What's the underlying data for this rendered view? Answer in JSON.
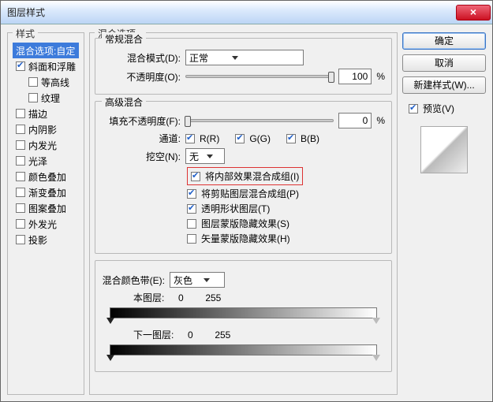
{
  "title": "图层样式",
  "left": {
    "legend": "样式",
    "items": [
      {
        "label": "混合选项:自定",
        "checked": null,
        "selected": true
      },
      {
        "label": "斜面和浮雕",
        "checked": true
      },
      {
        "label": "等高线",
        "checked": false,
        "indent": true
      },
      {
        "label": "纹理",
        "checked": false,
        "indent": true
      },
      {
        "label": "描边",
        "checked": false
      },
      {
        "label": "内阴影",
        "checked": false
      },
      {
        "label": "内发光",
        "checked": false
      },
      {
        "label": "光泽",
        "checked": false
      },
      {
        "label": "颜色叠加",
        "checked": false
      },
      {
        "label": "渐变叠加",
        "checked": false
      },
      {
        "label": "图案叠加",
        "checked": false
      },
      {
        "label": "外发光",
        "checked": false
      },
      {
        "label": "投影",
        "checked": false
      }
    ]
  },
  "mid": {
    "legend": "混合选项",
    "normal": {
      "legend": "常规混合",
      "mode_label": "混合模式(D):",
      "mode_value": "正常",
      "opacity_label": "不透明度(O):",
      "opacity_value": "100",
      "pct": "%"
    },
    "adv": {
      "legend": "高级混合",
      "fill_label": "填充不透明度(F):",
      "fill_value": "0",
      "pct": "%",
      "channels_label": "通道:",
      "r": "R(R)",
      "g": "G(G)",
      "b": "B(B)",
      "knock_label": "挖空(N):",
      "knock_value": "无",
      "opts": [
        {
          "label": "将内部效果混合成组(I)",
          "checked": true,
          "hl": true
        },
        {
          "label": "将剪贴图层混合成组(P)",
          "checked": true
        },
        {
          "label": "透明形状图层(T)",
          "checked": true
        },
        {
          "label": "图层蒙版隐藏效果(S)",
          "checked": false
        },
        {
          "label": "矢量蒙版隐藏效果(H)",
          "checked": false
        }
      ]
    },
    "blendif": {
      "label": "混合颜色带(E):",
      "value": "灰色",
      "this_label": "本图层:",
      "this_lo": "0",
      "this_hi": "255",
      "under_label": "下一图层:",
      "under_lo": "0",
      "under_hi": "255"
    }
  },
  "right": {
    "ok": "确定",
    "cancel": "取消",
    "newstyle": "新建样式(W)...",
    "preview": "预览(V)"
  }
}
